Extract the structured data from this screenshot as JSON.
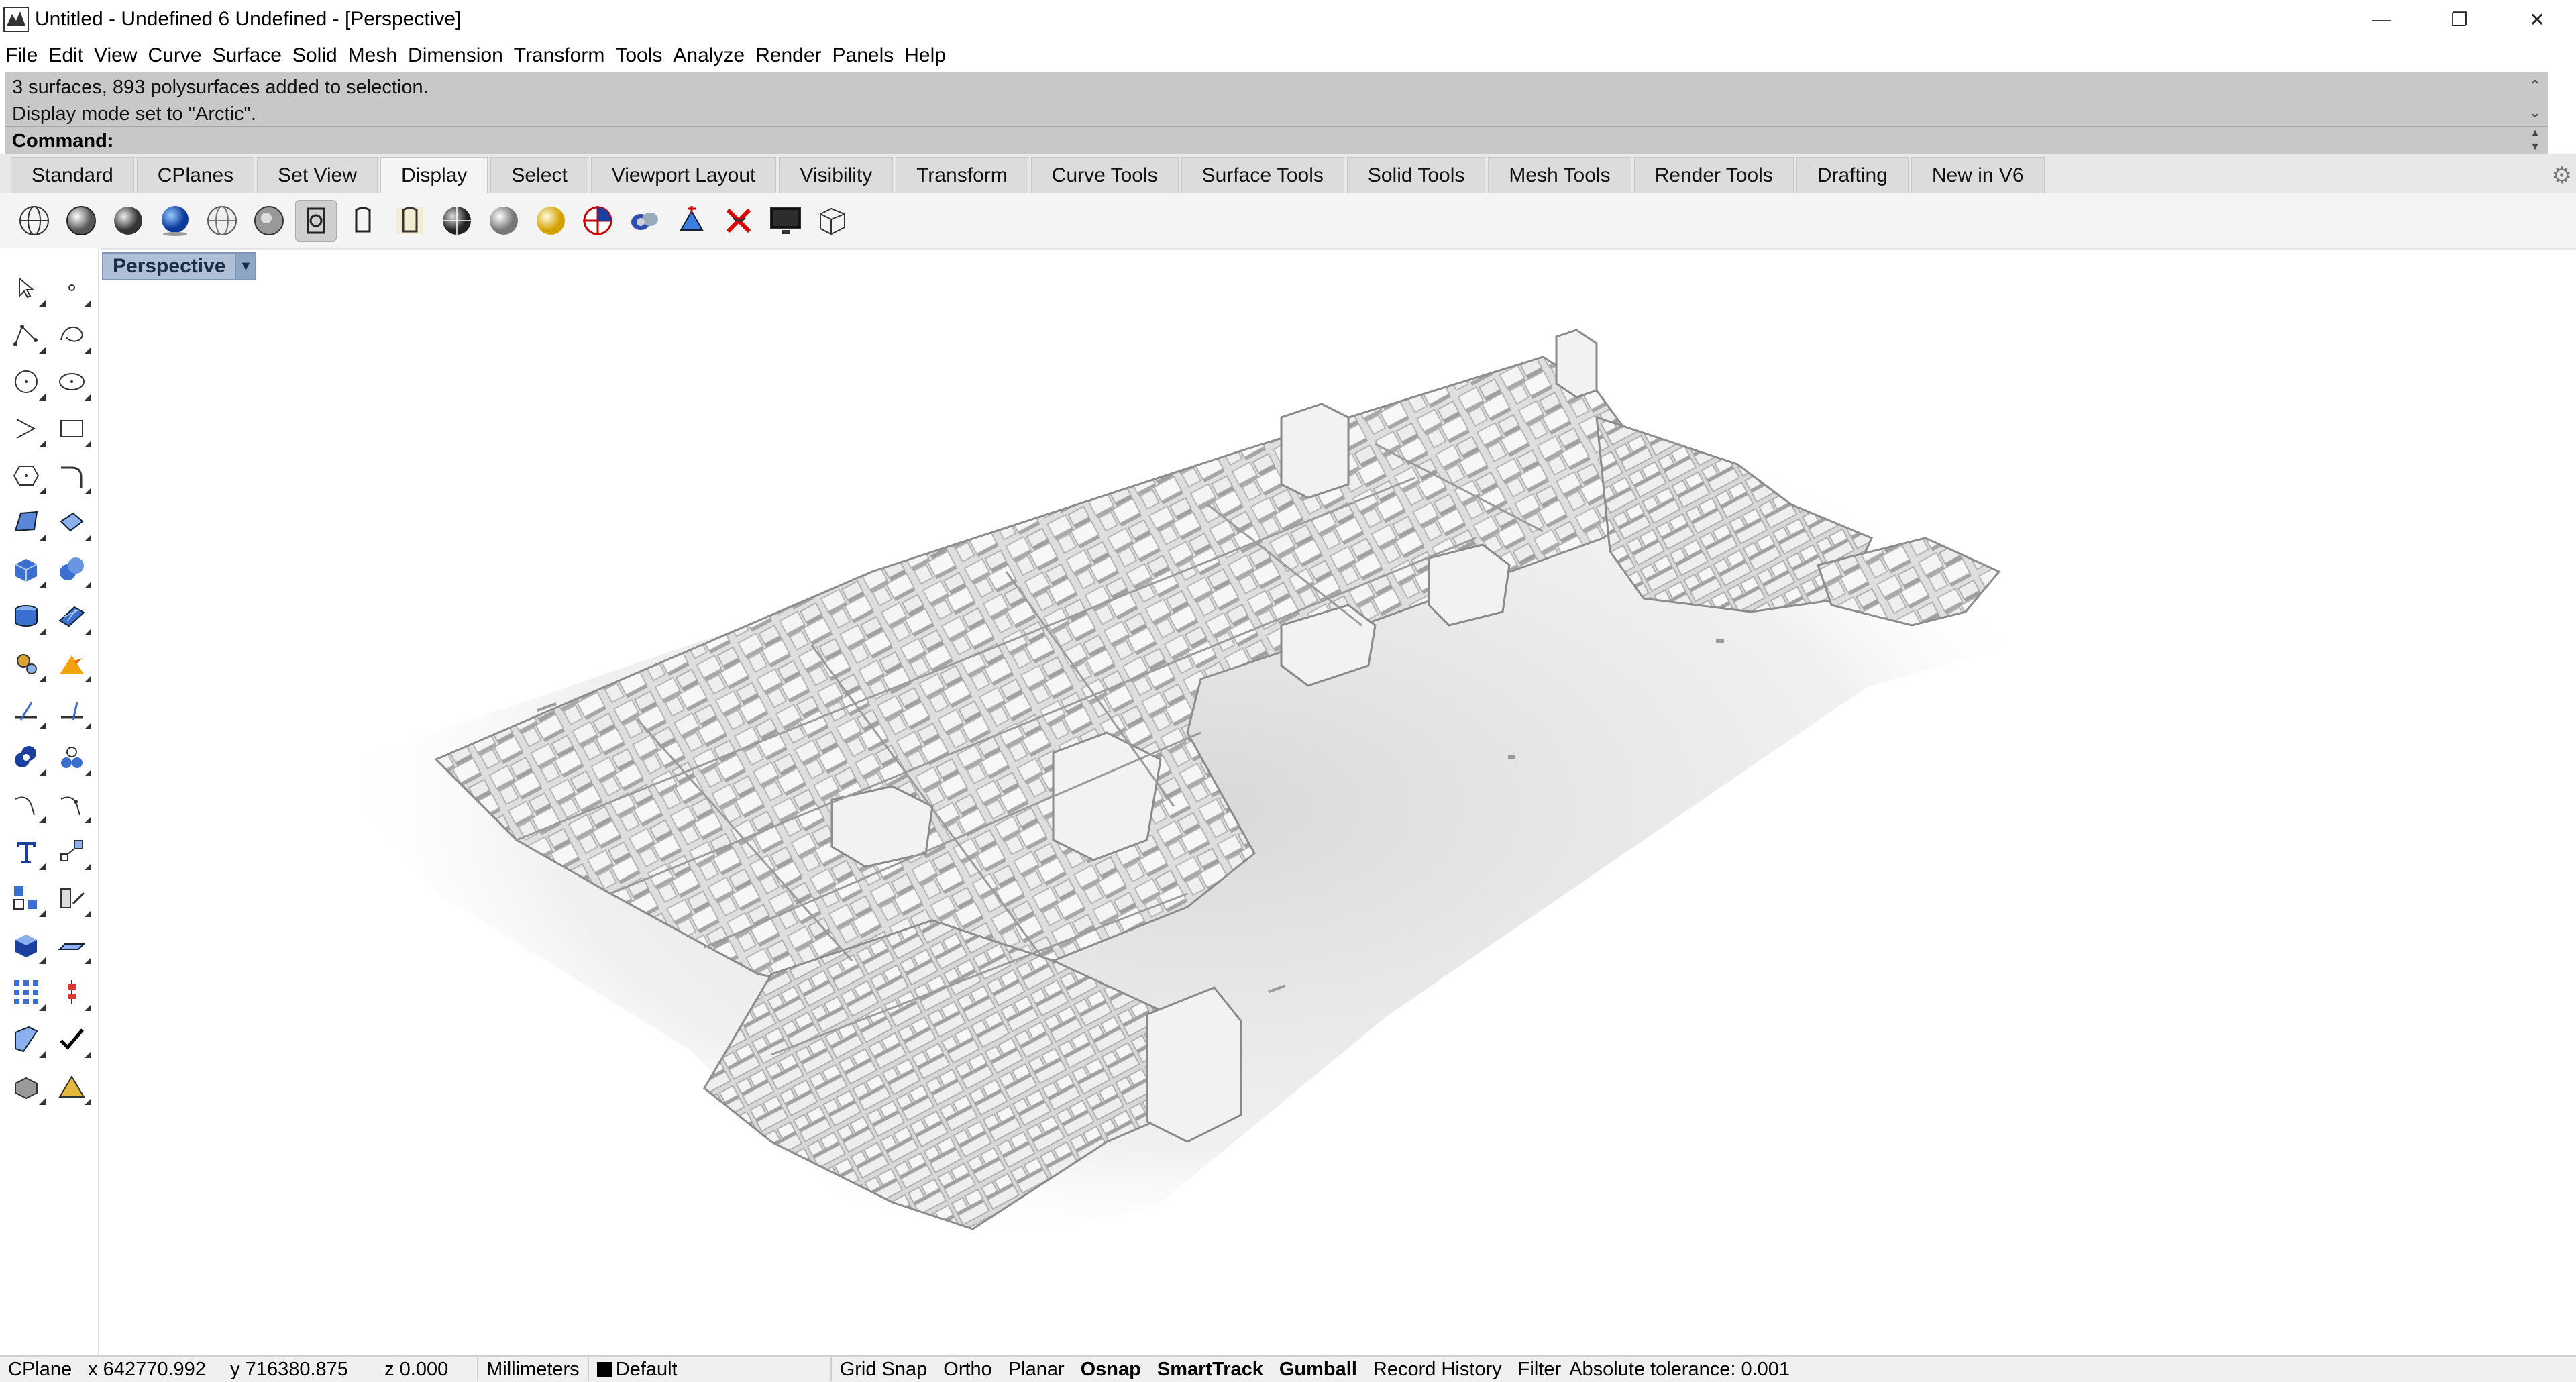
{
  "window": {
    "title": "Untitled - Undefined 6 Undefined - [Perspective]",
    "minimize": "—",
    "restore": "❐",
    "close": "✕"
  },
  "menu": [
    "File",
    "Edit",
    "View",
    "Curve",
    "Surface",
    "Solid",
    "Mesh",
    "Dimension",
    "Transform",
    "Tools",
    "Analyze",
    "Render",
    "Panels",
    "Help"
  ],
  "command": {
    "history_line1": "3 surfaces, 893 polysurfaces added to selection.",
    "history_line2": "Display mode set to \"Arctic\".",
    "prompt": "Command:"
  },
  "tabs": [
    "Standard",
    "CPlanes",
    "Set View",
    "Display",
    "Select",
    "Viewport Layout",
    "Visibility",
    "Transform",
    "Curve Tools",
    "Surface Tools",
    "Solid Tools",
    "Mesh Tools",
    "Render Tools",
    "Drafting",
    "New in V6"
  ],
  "active_tab": "Display",
  "display_tools": [
    "wireframe-icon",
    "shaded-icon",
    "rendered-icon",
    "rendered-sphere-icon",
    "ghosted-icon",
    "xray-icon",
    "technical-icon",
    "pen-icon",
    "artistic-icon",
    "material-sphere-icon",
    "gray-sphere-icon",
    "light-sphere-icon",
    "zebra-icon",
    "environment-map-icon",
    "draft-angle-icon",
    "curvature-icon",
    "screen-icon",
    "bounding-box-icon"
  ],
  "viewport": {
    "name": "Perspective"
  },
  "status": {
    "cplane": "CPlane",
    "x": "x 642770.992",
    "y": "y 716380.875",
    "z": "z 0.000",
    "units": "Millimeters",
    "layer": "Default",
    "grid_snap": "Grid Snap",
    "ortho": "Ortho",
    "planar": "Planar",
    "osnap": "Osnap",
    "smarttrack": "SmartTrack",
    "gumball": "Gumball",
    "record_history": "Record History",
    "filter": "Filter",
    "tolerance": "Absolute tolerance: 0.001"
  }
}
